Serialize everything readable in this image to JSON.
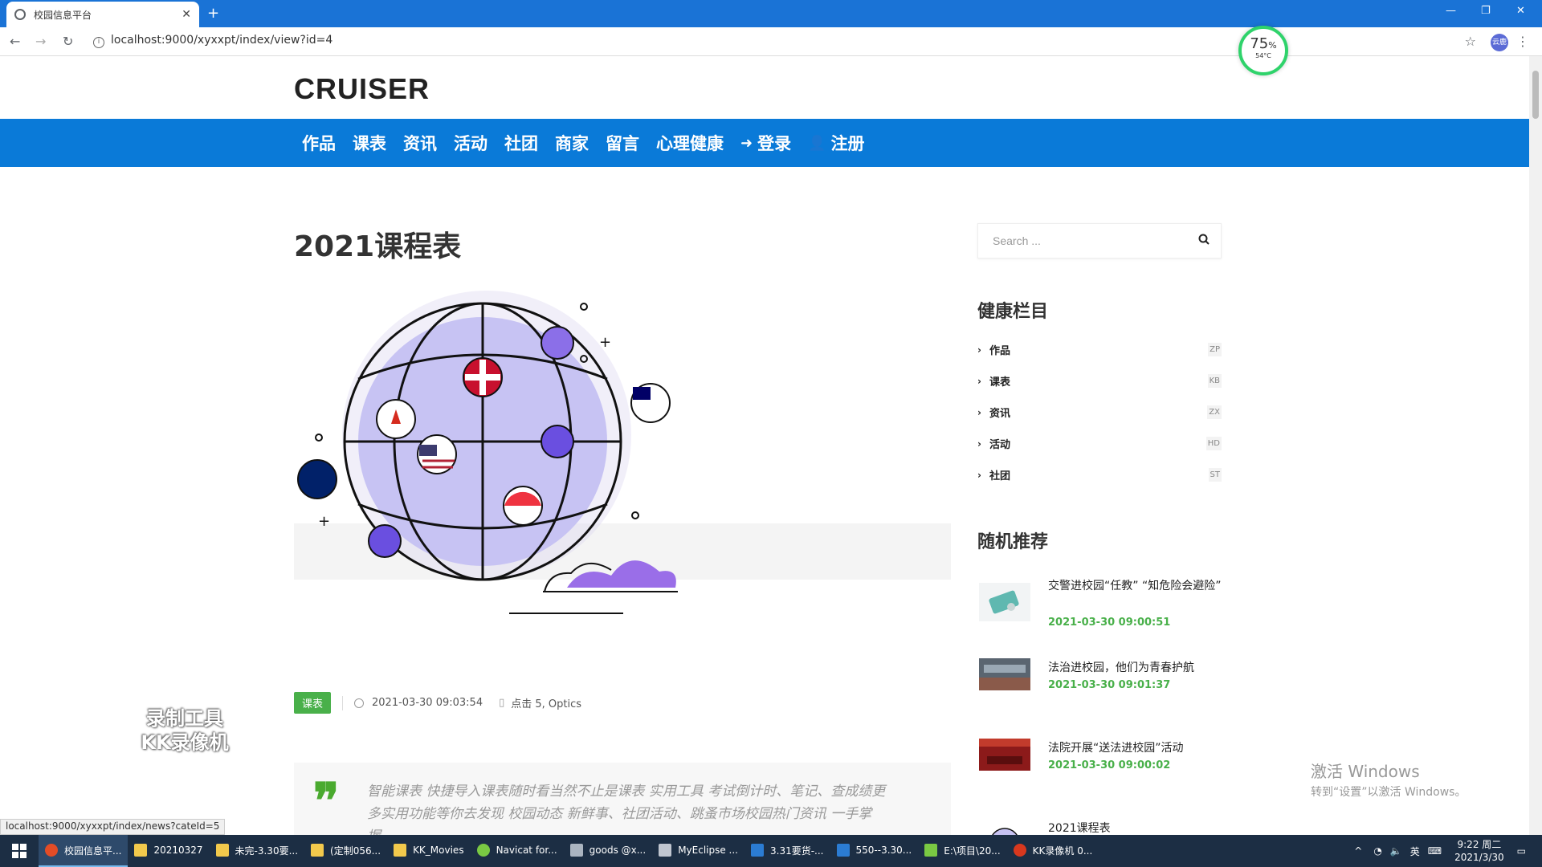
{
  "browser": {
    "tab_title": "校园信息平台",
    "url": "localhost:9000/xyxxpt/index/view?id=4",
    "profile_label": "云鹿"
  },
  "cpu_widget": {
    "percent": "75",
    "percent_sign": "%",
    "temp": "54°C"
  },
  "site": {
    "logo": "CRUISER",
    "nav": [
      {
        "label": "作品"
      },
      {
        "label": "课表"
      },
      {
        "label": "资讯"
      },
      {
        "label": "活动"
      },
      {
        "label": "社团"
      },
      {
        "label": "商家"
      },
      {
        "label": "留言"
      },
      {
        "label": "心理健康"
      },
      {
        "label": "登录",
        "icon": "login-icon"
      },
      {
        "label": "注册",
        "icon": "user-plus-icon"
      }
    ]
  },
  "article": {
    "title": "2021课程表",
    "badge": "课表",
    "datetime": "2021-03-30 09:03:54",
    "views": "点击 5, Optics",
    "quote": "智能课表 快捷导入课表随时看当然不止是课表 实用工具 考试倒计时、笔记、查成绩更多实用功能等你去发现 校园动态 新鲜事、社团活动、跳蚤市场校园热门资讯 一手掌握…"
  },
  "sidebar": {
    "search_placeholder": "Search ...",
    "health_heading": "健康栏目",
    "categories": [
      {
        "label": "作品",
        "code": "ZP"
      },
      {
        "label": "课表",
        "code": "KB"
      },
      {
        "label": "资讯",
        "code": "ZX"
      },
      {
        "label": "活动",
        "code": "HD"
      },
      {
        "label": "社团",
        "code": "ST"
      }
    ],
    "random_heading": "随机推荐",
    "recommendations": [
      {
        "title": "交警进校园“任教” “知危险会避险”",
        "date": "2021-03-30 09:00:51"
      },
      {
        "title": "法治进校园，他们为青春护航",
        "date": "2021-03-30 09:01:37"
      },
      {
        "title": "法院开展“送法进校园”活动",
        "date": "2021-03-30 09:00:02"
      },
      {
        "title": "2021课程表",
        "date": ""
      }
    ]
  },
  "overlay": {
    "kk_line1": "录制工具",
    "kk_line2": "KK录像机",
    "activate_line1": "激活 Windows",
    "activate_line2": "转到“设置”以激活 Windows。"
  },
  "status_url": "localhost:9000/xyxxpt/index/news?cateId=5",
  "taskbar": {
    "items": [
      {
        "label": "校园信息平...",
        "color": "#e34c26"
      },
      {
        "label": "20210327",
        "color": "#f2c94c"
      },
      {
        "label": "未完-3.30要...",
        "color": "#f2c94c"
      },
      {
        "label": "(定制056...",
        "color": "#f2c94c"
      },
      {
        "label": "KK_Movies",
        "color": "#f2c94c"
      },
      {
        "label": "Navicat for...",
        "color": "#7ac943"
      },
      {
        "label": "goods @x...",
        "color": "#aab4c0"
      },
      {
        "label": "MyEclipse ...",
        "color": "#c0c6d0"
      },
      {
        "label": "3.31要货-...",
        "color": "#2b7cd3"
      },
      {
        "label": "550--3.30...",
        "color": "#2b7cd3"
      },
      {
        "label": "E:\\项目\\20...",
        "color": "#7ac943"
      },
      {
        "label": "KK录像机 0...",
        "color": "#d8381e"
      }
    ],
    "ime": "英",
    "time": "9:22 周二",
    "date": "2021/3/30"
  }
}
